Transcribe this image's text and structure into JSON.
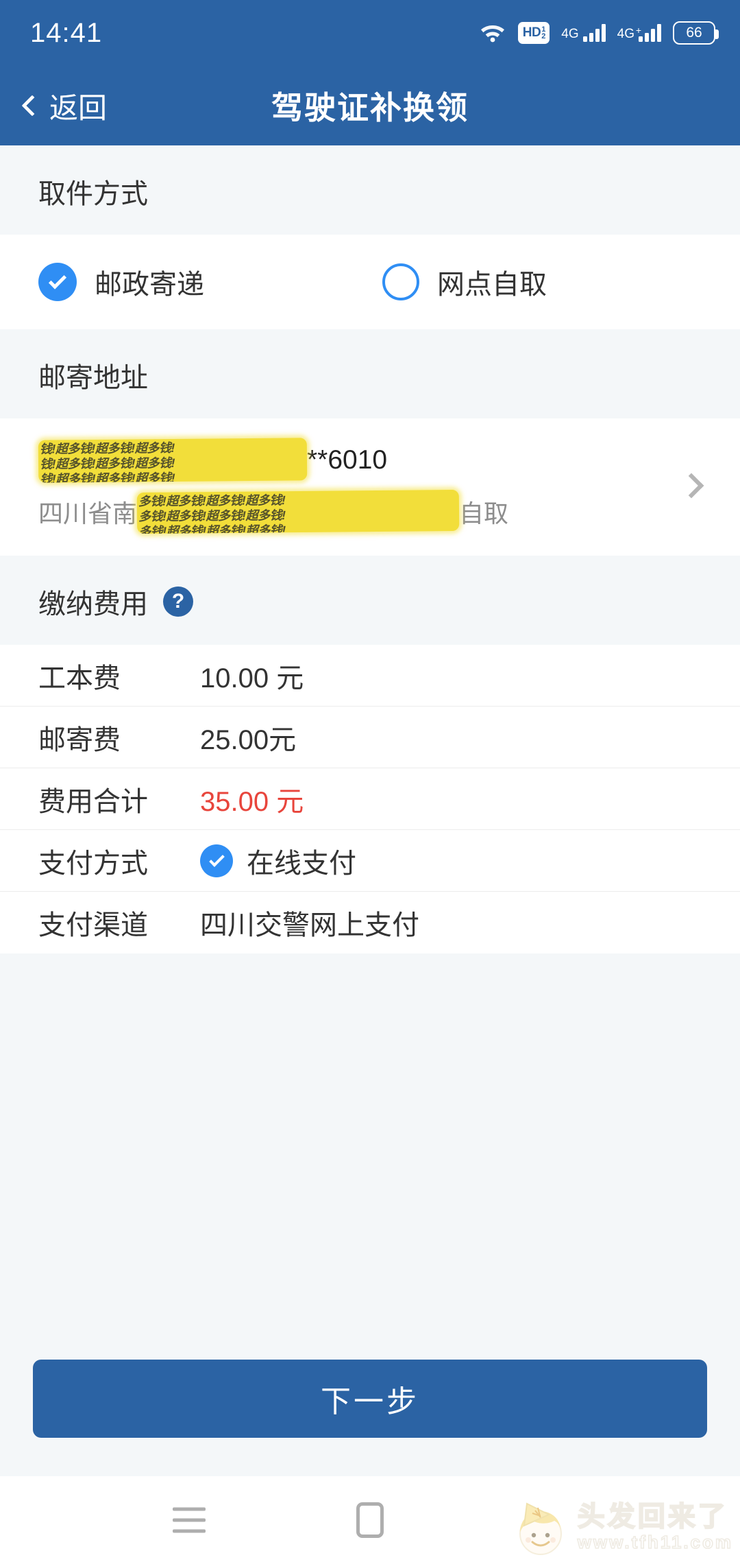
{
  "statusbar": {
    "time": "14:41",
    "wifi_icon": "wifi-icon",
    "hd_text": "HD",
    "hd_sim_top": "1",
    "hd_sim_bottom": "2",
    "signal1_label": "4G",
    "signal2_label": "4G",
    "signal2_plus": "+",
    "battery_level": "66"
  },
  "titlebar": {
    "back_label": "返回",
    "title": "驾驶证补换领"
  },
  "pickup": {
    "section_title": "取件方式",
    "options": [
      {
        "label": "邮政寄递",
        "selected": true
      },
      {
        "label": "网点自取",
        "selected": false
      }
    ]
  },
  "address": {
    "section_title": "邮寄地址",
    "line1_suffix": "**6010",
    "line1_redacted": "钱!超多钱!超多钱!超多钱!",
    "line2_prefix": "四川省南",
    "line2_suffix": "自取",
    "line2_redacted": "多钱!超多钱!超多钱!超多钱!",
    "chevron_icon": "chevron-right-icon"
  },
  "fees": {
    "section_title": "缴纳费用",
    "help_icon_label": "?",
    "rows": [
      {
        "label": "工本费",
        "value": "10.00 元",
        "type": "text"
      },
      {
        "label": "邮寄费",
        "value": "25.00元",
        "type": "text"
      },
      {
        "label": "费用合计",
        "value": "35.00 元",
        "type": "total"
      },
      {
        "label": "支付方式",
        "value": "在线支付",
        "type": "checked"
      },
      {
        "label": "支付渠道",
        "value": "四川交警网上支付",
        "type": "text"
      }
    ]
  },
  "action": {
    "next_label": "下一步"
  },
  "navbar": {
    "recents_icon": "menu-icon",
    "home_icon": "home-square-icon"
  },
  "watermark": {
    "title": "头发回来了",
    "url": "www.tfh11.com"
  },
  "colors": {
    "header_blue": "#2B63A4",
    "accent_blue": "#2F8EF4",
    "section_bg": "#F4F7F9",
    "total_red": "#E8453C",
    "redact_yellow": "#F2DE3A"
  }
}
